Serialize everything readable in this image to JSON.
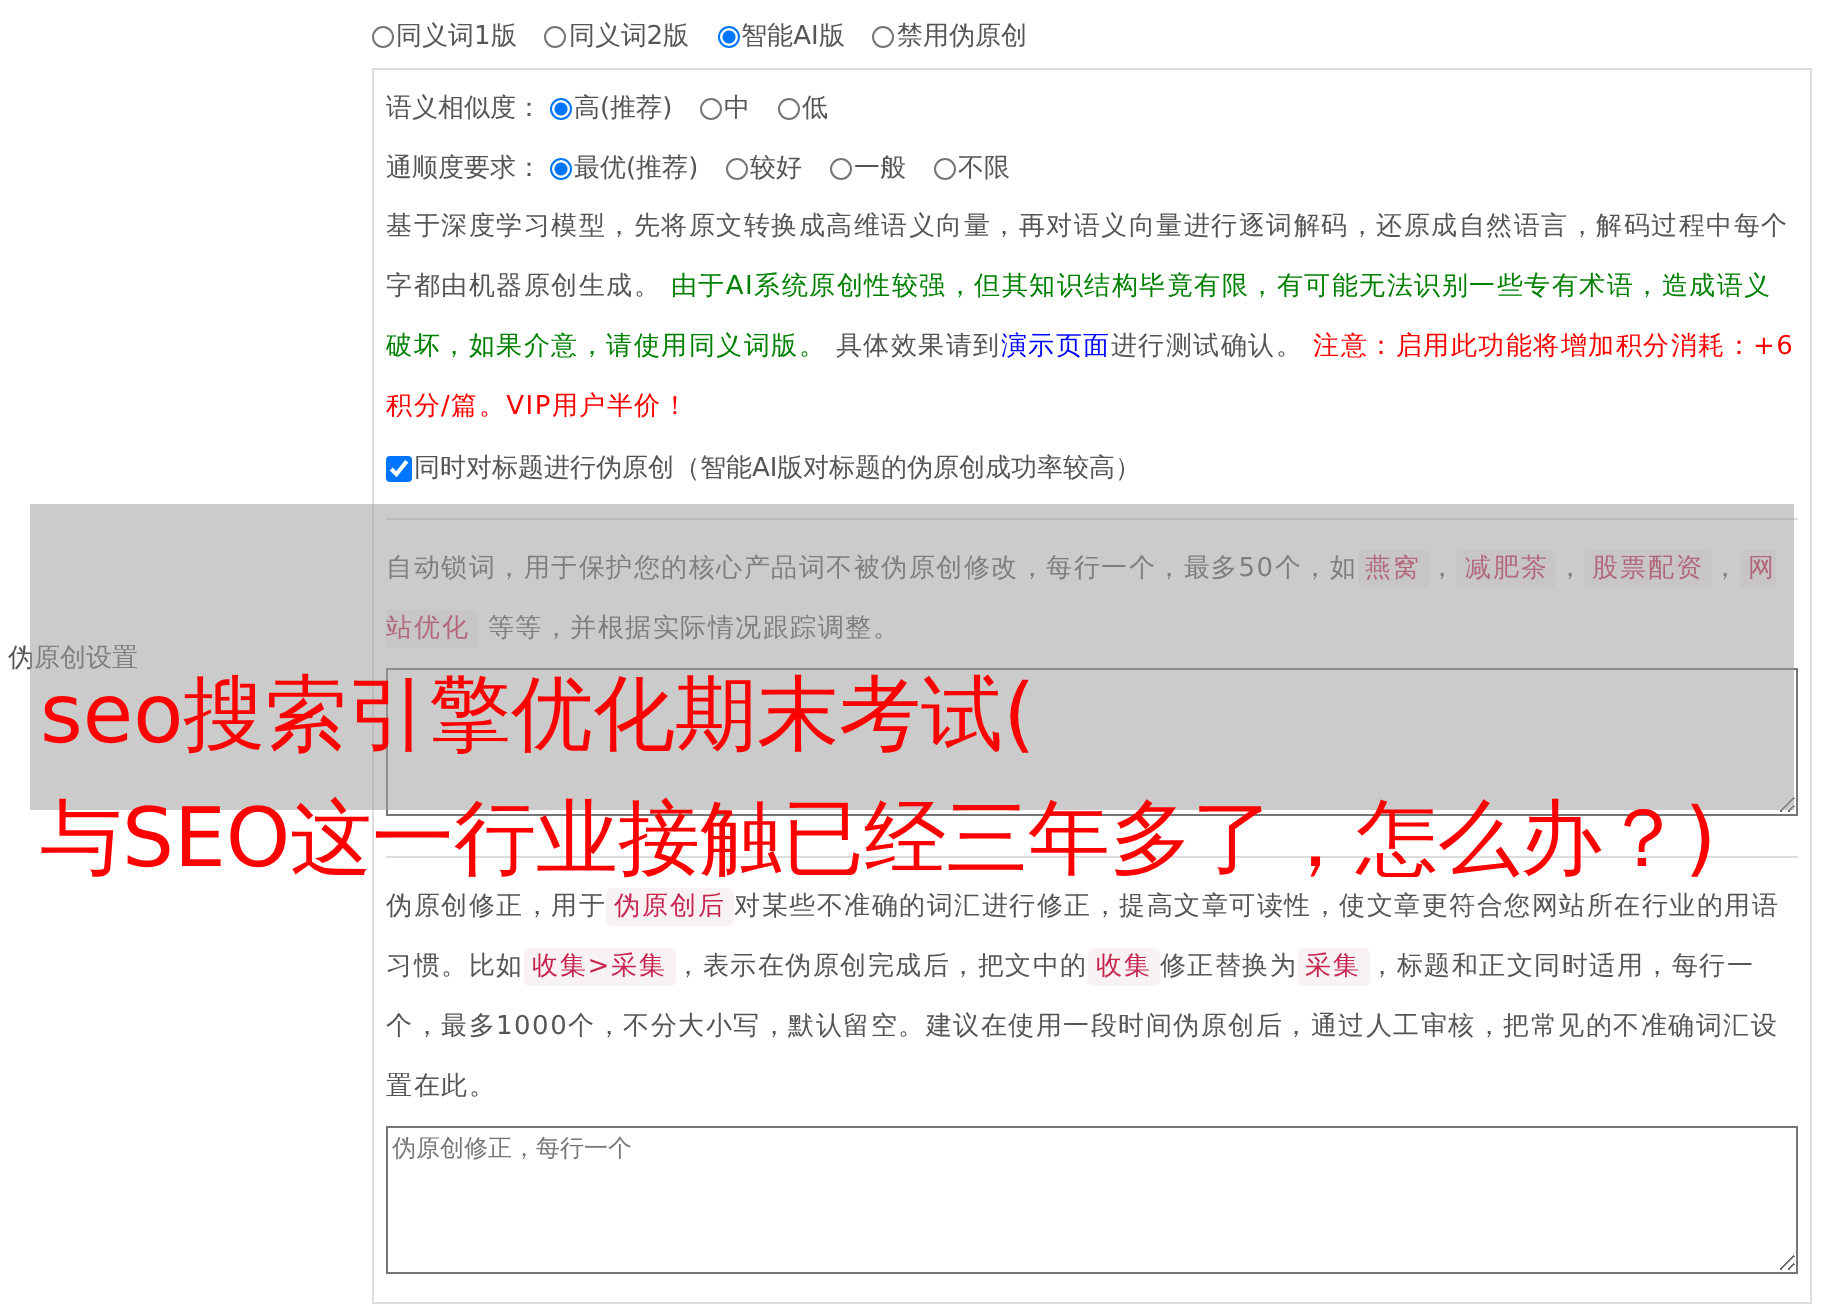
{
  "sidebar_label": "伪原创设置",
  "mode_options": [
    {
      "label": "同义词1版",
      "selected": false
    },
    {
      "label": "同义词2版",
      "selected": false
    },
    {
      "label": "智能AI版",
      "selected": true
    },
    {
      "label": "禁用伪原创",
      "selected": false
    }
  ],
  "ai_settings": {
    "similarity": {
      "label": "语义相似度：",
      "options": [
        {
          "label": "高(推荐)",
          "selected": true
        },
        {
          "label": "中",
          "selected": false
        },
        {
          "label": "低",
          "selected": false
        }
      ]
    },
    "fluency": {
      "label": "通顺度要求：",
      "options": [
        {
          "label": "最优(推荐)",
          "selected": true
        },
        {
          "label": "较好",
          "selected": false
        },
        {
          "label": "一般",
          "selected": false
        },
        {
          "label": "不限",
          "selected": false
        }
      ]
    },
    "description": [
      {
        "kind": "plain",
        "text": "基于深度学习模型，先将原文转换成高维语义向量，再对语义向量进行逐词解码，还原成自然语言，解码过程中每个字都由机器原创生成。 "
      },
      {
        "kind": "green",
        "text": "由于AI系统原创性较强，但其知识结构毕竟有限，有可能无法识别一些专有术语，造成语义破坏，如果介意，请使用同义词版。"
      },
      {
        "kind": "plain",
        "text": " 具体效果请到"
      },
      {
        "kind": "link",
        "text": "演示页面"
      },
      {
        "kind": "plain",
        "text": "进行测试确认。 "
      },
      {
        "kind": "red",
        "text": "注意：启用此功能将增加积分消耗：+6积分/篇。VIP用户半价！"
      }
    ],
    "title_checkbox": {
      "label": "同时对标题进行伪原创（智能AI版对标题的伪原创成功率较高）",
      "checked": true
    }
  },
  "lock_words": {
    "description": [
      {
        "kind": "plain",
        "text": "自动锁词，用于保护您的核心产品词不被伪原创修改，每行一个，最多50个，如"
      },
      {
        "kind": "code",
        "text": "燕窝"
      },
      {
        "kind": "plain",
        "text": "，"
      },
      {
        "kind": "code",
        "text": "减肥茶"
      },
      {
        "kind": "plain",
        "text": "，"
      },
      {
        "kind": "code",
        "text": "股票配资"
      },
      {
        "kind": "plain",
        "text": "，"
      },
      {
        "kind": "code",
        "text": "网站优化"
      },
      {
        "kind": "plain",
        "text": " 等等，并根据实际情况跟踪调整。"
      }
    ]
  },
  "corrections": {
    "description": [
      {
        "kind": "plain",
        "text": "伪原创修正，用于"
      },
      {
        "kind": "code",
        "text": "伪原创后"
      },
      {
        "kind": "plain",
        "text": "对某些不准确的词汇进行修正，提高文章可读性，使文章更符合您网站所在行业的用语习惯。比如"
      },
      {
        "kind": "code",
        "text": "收集>采集"
      },
      {
        "kind": "plain",
        "text": "，表示在伪原创完成后，把文中的"
      },
      {
        "kind": "code",
        "text": "收集"
      },
      {
        "kind": "plain",
        "text": "修正替换为"
      },
      {
        "kind": "code",
        "text": "采集"
      },
      {
        "kind": "plain",
        "text": "，标题和正文同时适用，每行一个，最多1000个，不分大小写，默认留空。建议在使用一段时间伪原创后，通过人工审核，把常见的不准确词汇设置在此。"
      }
    ],
    "placeholder": "伪原创修正，每行一个"
  },
  "overlay_title": [
    "seo搜索引擎优化期末考试(",
    "与SEO这一行业接触已经三年多了，怎么办？)"
  ]
}
